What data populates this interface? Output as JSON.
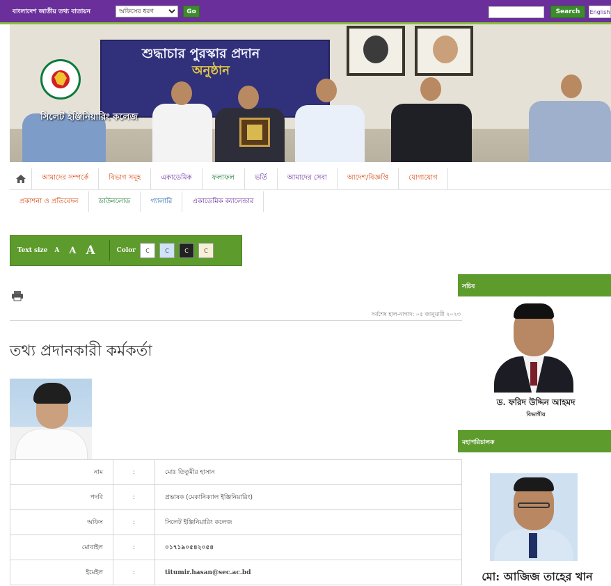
{
  "topbar": {
    "portal_label": "বাংলাদেশ জাতীয় তথ্য বাতায়ন",
    "office_select": "অফিসের ধরণ",
    "go_label": "Go",
    "search_placeholder": "",
    "search_label": "Search",
    "lang_label": "English",
    "color": "#6a2f9a"
  },
  "banner": {
    "college_name": "সিলেট ইঞ্জিনিয়ারিং কলেজ",
    "board_title": "শুদ্ধাচার পুরস্কার প্রদান",
    "board_subtitle": "অনুষ্ঠান"
  },
  "nav": {
    "row1": [
      {
        "label": "আমাদের সম্পর্কে"
      },
      {
        "label": "বিভাগ সমূহ"
      },
      {
        "label": "একাডেমিক"
      },
      {
        "label": "ফলাফল"
      },
      {
        "label": "ভর্তি"
      },
      {
        "label": "আমাদের সেবা"
      },
      {
        "label": "আদেশ/বিজ্ঞপ্তি"
      },
      {
        "label": "যোগাযোগ"
      }
    ],
    "row2": [
      {
        "label": "প্রকাশনা ও প্রতিবেদন"
      },
      {
        "label": "ডাউনলোড"
      },
      {
        "label": "গ্যালারি"
      },
      {
        "label": "একাডেমিক ক্যালেন্ডার"
      }
    ]
  },
  "a11y": {
    "text_size_label": "Text size",
    "sizes": [
      "A",
      "A",
      "A"
    ],
    "color_label": "Color",
    "swatches": [
      {
        "label": "C",
        "bg": "#ffffff",
        "fg": "#444444"
      },
      {
        "label": "C",
        "bg": "#cfe2f7",
        "fg": "#444444"
      },
      {
        "label": "C",
        "bg": "#222222",
        "fg": "#ffffff"
      },
      {
        "label": "C",
        "bg": "#f6f0d6",
        "fg": "#444444"
      }
    ],
    "accent": "#5d9b2c"
  },
  "content": {
    "updated": "সর্বশেষ হাল-নাগাদ: ০৫ জানুয়ারী ২০২৩",
    "title": "তথ্য প্রদানকারী কর্মকর্তা",
    "rows": [
      {
        "key": "নাম",
        "colon": ":",
        "value": "মোঃ তিতুমীর হাসান"
      },
      {
        "key": "পদবি",
        "colon": ":",
        "value": "প্রভাষক (মেকানিক্যাল ইঞ্জিনিয়ারিং)"
      },
      {
        "key": "অফিস",
        "colon": ":",
        "value": "সিলেট ইঞ্জিনিয়ারিং কলেজ"
      },
      {
        "key": "মোবাইল",
        "colon": ":",
        "value": "০১৭১৯০৫৪২০৫৪"
      },
      {
        "key": "ইমেইল",
        "colon": ":",
        "value": "titumir.hasan@sec.ac.bd"
      }
    ]
  },
  "sidebar": {
    "sections": [
      {
        "heading": "সচিব",
        "name": "ড. ফরিদ উদ্দিন আহমদ",
        "role": "বিভাগীয়"
      },
      {
        "heading": "মহাপরিচালক",
        "name": "মো: আজিজ তাহের খান",
        "role": ""
      }
    ]
  }
}
